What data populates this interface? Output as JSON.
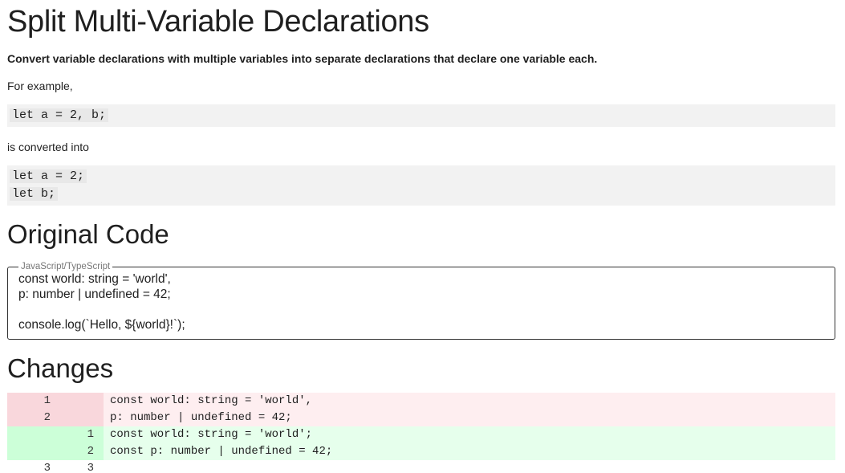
{
  "page_title": "Split Multi-Variable Declarations",
  "subtitle": "Convert variable declarations with multiple variables into separate declarations that declare one variable each.",
  "example_intro": "For example,",
  "example_before": [
    "let a = 2, b;"
  ],
  "converted_text": "is converted into",
  "example_after": [
    "let a = 2;",
    "let b;"
  ],
  "original_heading": "Original Code",
  "editor": {
    "legend": "JavaScript/TypeScript",
    "lines": [
      "const world: string = 'world',",
      "p: number | undefined = 42;",
      "",
      "console.log(`Hello, ${world}!`);"
    ]
  },
  "changes_heading": "Changes",
  "diff": [
    {
      "type": "removed",
      "old": "1",
      "new": "",
      "code": "const world: string = 'world',"
    },
    {
      "type": "removed",
      "old": "2",
      "new": "",
      "code": "p: number | undefined = 42;"
    },
    {
      "type": "added",
      "old": "",
      "new": "1",
      "code": "const world: string = 'world';"
    },
    {
      "type": "added",
      "old": "",
      "new": "2",
      "code": "const p: number | undefined = 42;"
    },
    {
      "type": "plain",
      "old": "3",
      "new": "3",
      "code": ""
    }
  ]
}
